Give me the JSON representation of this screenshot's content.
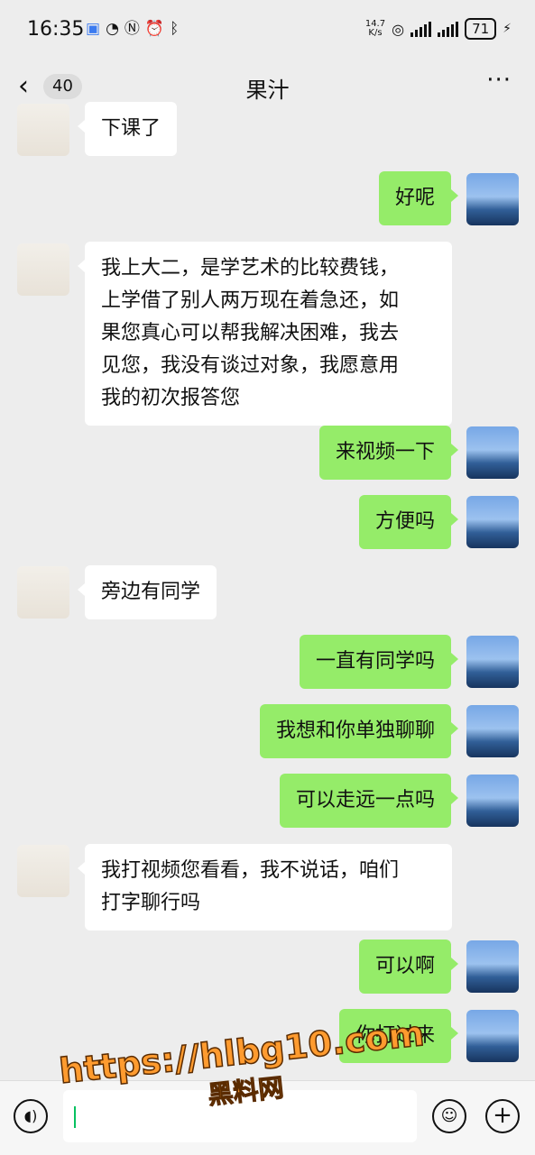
{
  "status_bar": {
    "time": "16:35",
    "net_speed_value": "14.7",
    "net_speed_unit": "K/s",
    "battery": "71"
  },
  "nav": {
    "unread_count": "40",
    "title": "果汁"
  },
  "messages": [
    {
      "side": "left",
      "text": "下课了"
    },
    {
      "side": "right",
      "text": "好呢"
    },
    {
      "side": "left",
      "lines": [
        "我上大二，是学艺术的比较费钱，",
        "上学借了别人两万现在着急还，如",
        "果您真心可以帮我解决困难，我去",
        "见您，我没有谈过对象，我愿意用",
        "我的初次报答您"
      ]
    },
    {
      "side": "right",
      "text": "来视频一下"
    },
    {
      "side": "right",
      "text": "方便吗"
    },
    {
      "side": "left",
      "text": "旁边有同学"
    },
    {
      "side": "right",
      "text": "一直有同学吗"
    },
    {
      "side": "right",
      "text": "我想和你单独聊聊"
    },
    {
      "side": "right",
      "text": "可以走远一点吗"
    },
    {
      "side": "left",
      "lines": [
        "我打视频您看看，我不说话，咱们",
        "打字聊行吗"
      ]
    },
    {
      "side": "right",
      "text": "可以啊"
    },
    {
      "side": "right",
      "text": "你打过来"
    }
  ],
  "watermark": {
    "url": "https://hlbg10.com",
    "brand": "黑料网"
  }
}
